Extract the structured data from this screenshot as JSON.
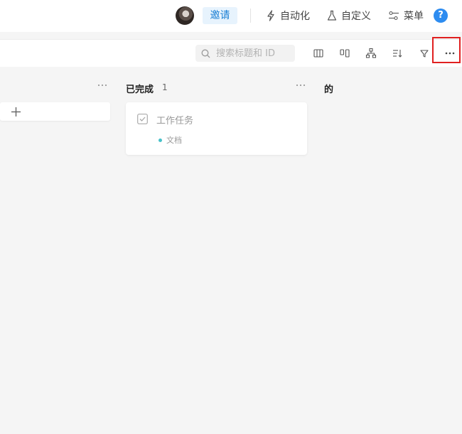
{
  "header": {
    "invite_label": "邀请",
    "automation_label": "自动化",
    "customize_label": "自定义",
    "menu_label": "菜单",
    "help_label": "?"
  },
  "toolbar": {
    "search_placeholder": "搜索标题和 ID"
  },
  "board": {
    "columns": [
      {
        "title": "",
        "count": ""
      },
      {
        "title": "已完成",
        "count": "1",
        "cards": [
          {
            "title": "工作任务",
            "tag": "文档",
            "tag_color": "#47c1c9"
          }
        ]
      },
      {
        "title": "的",
        "count": ""
      }
    ]
  },
  "colors": {
    "accent": "#1a7fd4",
    "invite_bg": "#e7f3fd",
    "help": "#2d8cf0",
    "highlight": "#e02020"
  }
}
